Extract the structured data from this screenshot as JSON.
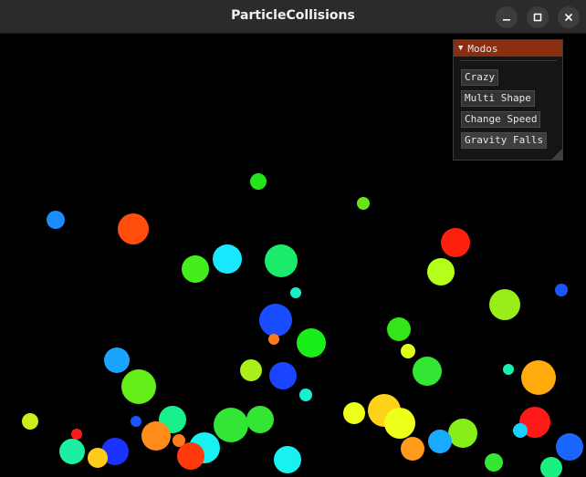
{
  "window": {
    "title": "ParticleCollisions"
  },
  "icons": {
    "minimize": "minimize-icon",
    "maximize": "maximize-icon",
    "close": "close-icon",
    "collapse": "triangle-down-icon"
  },
  "panel": {
    "title": "Modos",
    "collapse_glyph": "▼",
    "buttons": [
      "Crazy",
      "Multi Shape",
      "Change Speed",
      "Gravity Falls"
    ]
  },
  "colors": {
    "background": "#000000",
    "panel_header": "#8a2e12",
    "panel_bg": "#161616"
  }
}
